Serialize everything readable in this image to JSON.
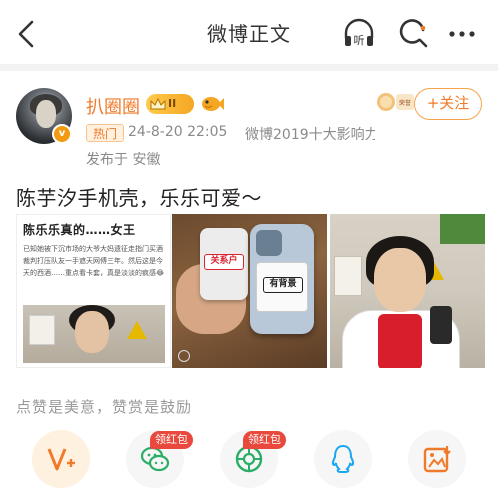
{
  "header": {
    "title": "微博正文",
    "listen_label": "听"
  },
  "author": {
    "name": "扒圈圈",
    "vip_level": "II",
    "hot_tag": "热门",
    "time": "24-8-20 22:05",
    "source": "微博2019十大影响力...",
    "location": "发布于 安徽",
    "follow_label": "+关注",
    "medal_text": "荣誉"
  },
  "post": {
    "text": "陈芋汐手机壳，乐乐可爱～",
    "images": [
      {
        "caption_title": "陈乐乐真的……女王",
        "caption_body": "已知她被下沉市场的大爷大妈遗征走指门买酒裁判打压队友一手遮天网傅三年。然后这是今天的西酒……重点看卡套，真是淡淡的疯感😂"
      },
      {
        "case_label_1": "关系户",
        "case_label_2": "有背景"
      },
      {}
    ]
  },
  "reward": {
    "text": "点赞是美意，赞赏是鼓励"
  },
  "share": {
    "items": [
      {
        "name": "reward",
        "badge": ""
      },
      {
        "name": "wechat",
        "badge": "领红包"
      },
      {
        "name": "moments",
        "badge": "领红包"
      },
      {
        "name": "qq",
        "badge": ""
      },
      {
        "name": "save-image",
        "badge": ""
      }
    ]
  },
  "colors": {
    "accent": "#f07a2a",
    "follow_border": "#f7a34d",
    "red_packet": "#e8493c"
  }
}
